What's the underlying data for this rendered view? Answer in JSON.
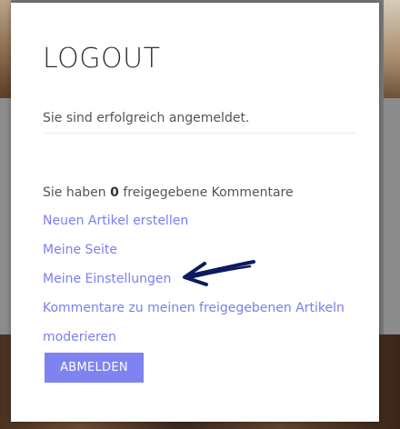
{
  "modal": {
    "title": "LOGOUT",
    "status_text": "Sie sind erfolgreich angemeldet.",
    "comments": {
      "prefix": "Sie haben ",
      "count": "0",
      "suffix": " freigegebene Kommentare"
    },
    "links": {
      "new_article": "Neuen Artikel erstellen",
      "my_page": "Meine Seite",
      "my_settings": "Meine Einstellungen",
      "moderate_line1": "Kommentare zu meinen freigegebenen Artikeln",
      "moderate_line2": "moderieren"
    },
    "logout_button": "ABMELDEN"
  },
  "annotation": {
    "icon": "hand-drawn-arrow-icon",
    "color": "#0b1b5e"
  },
  "colors": {
    "link": "#7a7ef0",
    "button": "#7f83f2"
  }
}
